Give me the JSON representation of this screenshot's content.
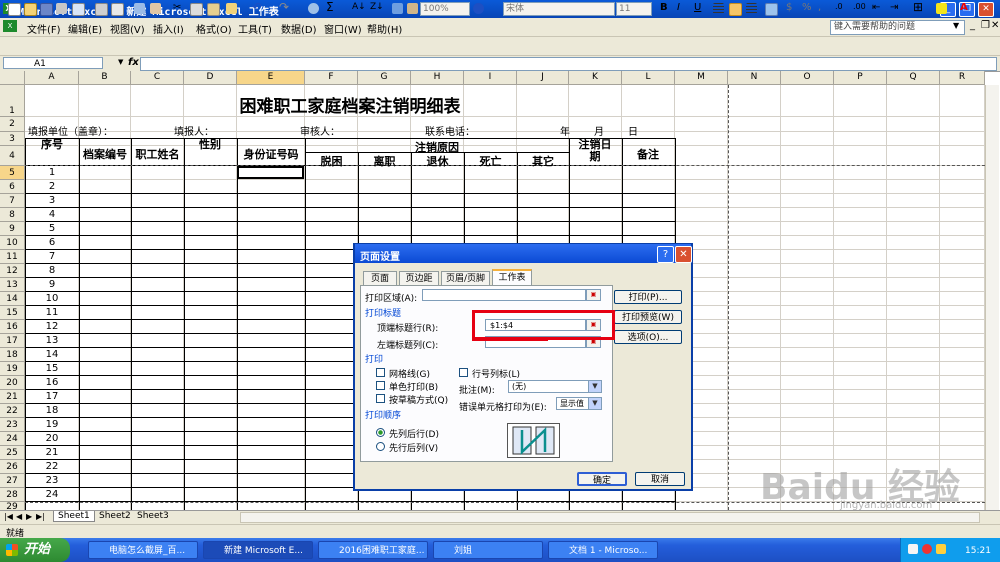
{
  "window": {
    "title": "Microsoft Excel - 新建 Microsoft Excel 工作表"
  },
  "menu": [
    "文件(F)",
    "编辑(E)",
    "视图(V)",
    "插入(I)",
    "格式(O)",
    "工具(T)",
    "数据(D)",
    "窗口(W)",
    "帮助(H)"
  ],
  "help_placeholder": "键入需要帮助的问题",
  "toolbar": {
    "zoom": "100%",
    "font": "宋体",
    "size": "11"
  },
  "formula": {
    "namebox": "A1",
    "fx": "fx"
  },
  "columns": [
    "A",
    "B",
    "C",
    "D",
    "E",
    "F",
    "G",
    "H",
    "I",
    "J",
    "K",
    "L",
    "M",
    "N",
    "O",
    "P",
    "Q",
    "R"
  ],
  "rows": [
    "1",
    "2",
    "3",
    "4",
    "5",
    "6",
    "7",
    "8",
    "9",
    "10",
    "11",
    "12",
    "13",
    "14",
    "15",
    "16",
    "17",
    "18",
    "19",
    "20",
    "21",
    "22",
    "23",
    "24",
    "25",
    "26",
    "27",
    "28",
    "29"
  ],
  "sheet": {
    "title": "困难职工家庭档案注销明细表",
    "r2": [
      "填报单位（盖章）：",
      "填报人：",
      "审核人：",
      "联系电话：",
      "年",
      "月",
      "日"
    ],
    "h_seq": "序号",
    "h_file": "档案编号",
    "h_name": "职工姓名",
    "h_sex": "性别",
    "h_id": "身份证号码",
    "h_reason": "注销原因",
    "h_reasons": [
      "脱困",
      "离职",
      "退休",
      "死亡",
      "其它"
    ],
    "h_date": "注销日期",
    "h_note": "备注",
    "seq": [
      "1",
      "2",
      "3",
      "4",
      "5",
      "6",
      "7",
      "8",
      "9",
      "10",
      "11",
      "12",
      "13",
      "14",
      "15",
      "16",
      "17",
      "18",
      "19",
      "20",
      "21",
      "22",
      "23",
      "24"
    ]
  },
  "tabs": [
    "Sheet1",
    "Sheet2",
    "Sheet3"
  ],
  "status": "就绪",
  "dialog": {
    "title": "页面设置",
    "tabs": [
      "页面",
      "页边距",
      "页眉/页脚",
      "工作表"
    ],
    "print_area": "打印区域(A):",
    "print_titles": "打印标题",
    "top_rows": "顶端标题行(R):",
    "top_rows_value": "$1:$4",
    "left_cols": "左端标题列(C):",
    "print": "打印",
    "gridlines": "网格线(G)",
    "row_col_headings": "行号列标(L)",
    "mono": "单色打印(B)",
    "draft": "按草稿方式(Q)",
    "comments": "批注(M):",
    "comments_value": "(无)",
    "errors": "错误单元格打印为(E):",
    "errors_value": "显示值",
    "order": "打印顺序",
    "down_over": "先列后行(D)",
    "over_down": "先行后列(V)",
    "btn_print": "打印(P)...",
    "btn_preview": "打印预览(W)",
    "btn_options": "选项(O)...",
    "ok": "确定",
    "cancel": "取消"
  },
  "taskbar": {
    "start": "开始",
    "tasks": [
      "电脑怎么截屏_百...",
      "新建 Microsoft E...",
      "2016困难职工家庭...",
      "刘姐",
      "文档 1 - Microso..."
    ],
    "time": "15:21"
  },
  "watermark": {
    "brand": "Baidu 经验",
    "url": "jingyan.baidu.com"
  }
}
